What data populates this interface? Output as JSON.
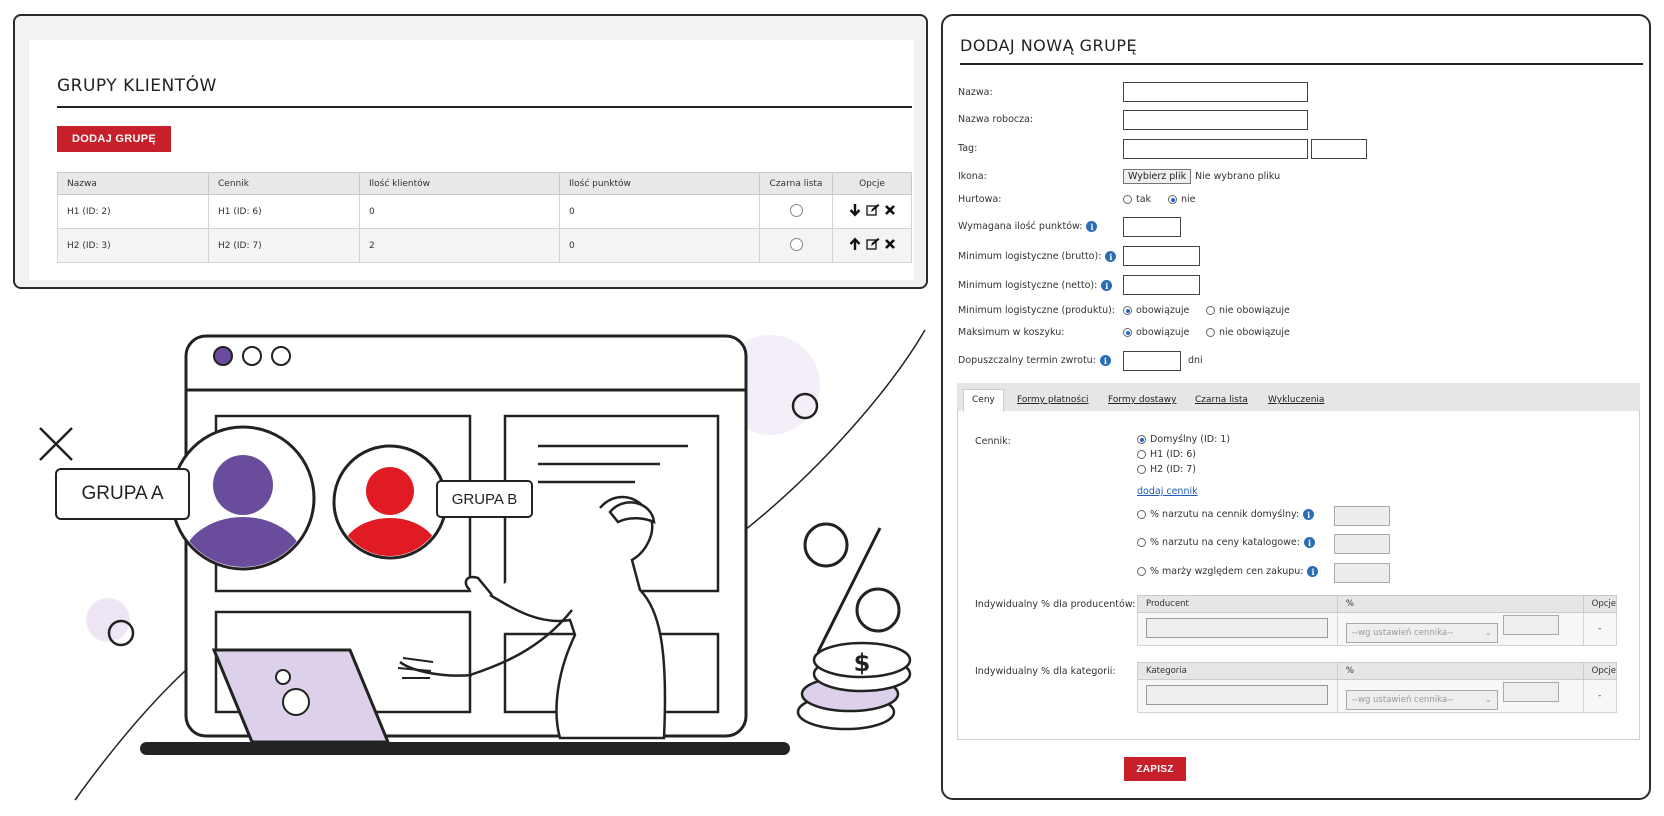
{
  "groups_panel": {
    "title": "GRUPY KLIENTÓW",
    "add_button": "DODAJ GRUPĘ",
    "columns": [
      "Nazwa",
      "Cennik",
      "Ilość klientów",
      "Ilość punktów",
      "Czarna lista",
      "Opcje"
    ],
    "rows": [
      {
        "name": "H1 (ID: 2)",
        "pricelist": "H1 (ID: 6)",
        "clients": "0",
        "points": "0"
      },
      {
        "name": "H2 (ID: 3)",
        "pricelist": "H2 (ID: 7)",
        "clients": "2",
        "points": "0"
      }
    ]
  },
  "form": {
    "title": "DODAJ NOWĄ GRUPĘ",
    "labels": {
      "name": "Nazwa:",
      "work_name": "Nazwa robocza:",
      "tag": "Tag:",
      "icon": "Ikona:",
      "wholesale": "Hurtowa:",
      "required_points": "Wymagana ilość punktów:",
      "min_gross": "Minimum logistyczne (brutto):",
      "min_net": "Minimum logistyczne (netto):",
      "min_product": "Minimum logistyczne (produktu):",
      "max_cart": "Maksimum w koszyku:",
      "return_term": "Dopuszczalny termin zwrotu:"
    },
    "file_button": "Wybierz plik",
    "file_status": "Nie wybrano pliku",
    "wholesale_options": [
      "tak",
      "nie"
    ],
    "applies": "obowiązuje",
    "not_applies": "nie obowiązuje",
    "days_unit": "dni",
    "tabs": [
      "Ceny",
      "Formy płatności",
      "Formy dostawy",
      "Czarna lista",
      "Wykluczenia"
    ],
    "pricelist_label": "Cennik:",
    "pricelist_options": [
      "Domyślny (ID: 1)",
      "H1 (ID: 6)",
      "H2 (ID: 7)"
    ],
    "add_pricelist_link": "dodaj cennik",
    "markup_options": [
      "% narzutu na cennik domyślny:",
      "% narzutu na ceny katalogowe:",
      "% marży względem cen zakupu:"
    ],
    "producers_label": "Indywidualny % dla producentów:",
    "categories_label": "Indywidualny % dla kategorii:",
    "producer_cols": [
      "Producent",
      "%",
      "Opcje"
    ],
    "category_cols": [
      "Kategoria",
      "%",
      "Opcje"
    ],
    "select_placeholder": "--wg ustawień cennika--",
    "options_dash": "-",
    "save_button": "ZAPISZ"
  },
  "illustration": {
    "bubble_a": "GRUPA A",
    "bubble_b": "GRUPA B",
    "percent_symbol": "%",
    "coin_symbol": "$"
  },
  "colors": {
    "accent_red": "#c8202a",
    "info_blue": "#2a6db5",
    "avatar_purple": "#6a4c9c",
    "avatar_red": "#e01b24",
    "laptop_lilac": "#ddd0ea"
  }
}
